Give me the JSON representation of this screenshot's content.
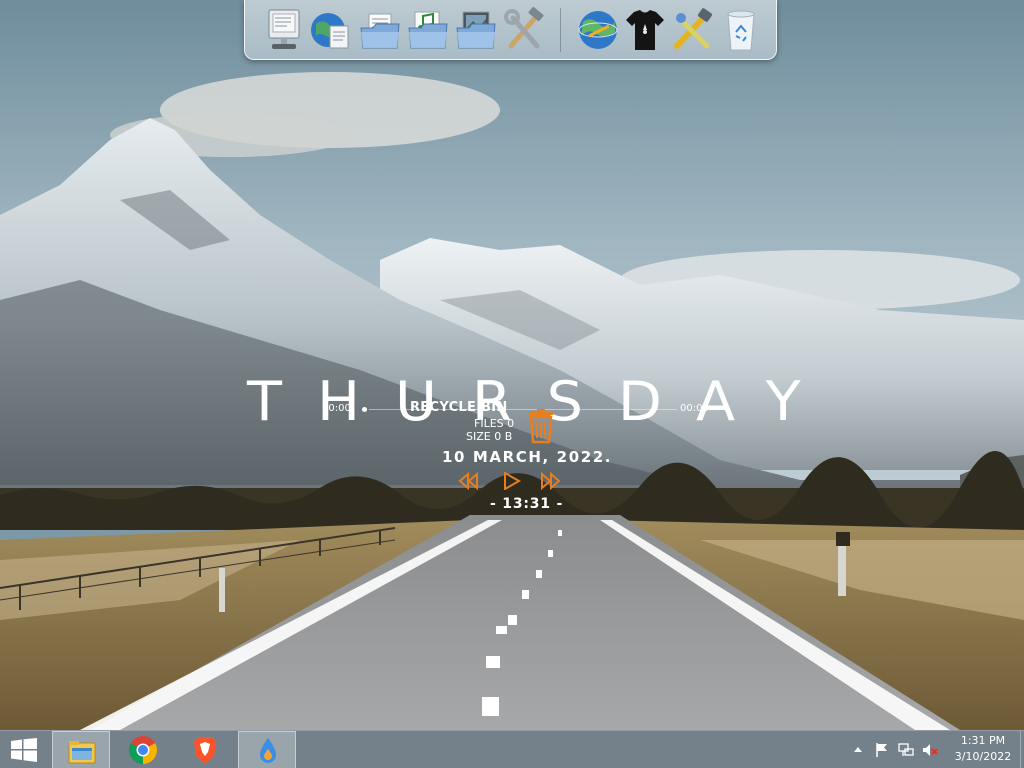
{
  "desktop": {
    "day_name": "THURSDAY",
    "date": "10  MARCH,  2022.",
    "clock": "- 13:31 -",
    "recycle_bin": {
      "title": "RECYCLE BIN",
      "files": "FILES 0",
      "size": "SIZE 0 B"
    },
    "media": {
      "elapsed": "00:00",
      "remaining": "00:00",
      "progress": 0,
      "accent_color": "#e67e22"
    }
  },
  "dock": {
    "icons": [
      {
        "name": "computer-icon"
      },
      {
        "name": "network-places-icon"
      },
      {
        "name": "documents-folder-icon"
      },
      {
        "name": "music-folder-icon"
      },
      {
        "name": "pictures-folder-icon"
      },
      {
        "name": "tools-icon"
      },
      {
        "name": "internet-globe-icon"
      },
      {
        "name": "tshirt-icon"
      },
      {
        "name": "settings-tools-icon"
      },
      {
        "name": "recycle-bin-icon"
      }
    ]
  },
  "taskbar": {
    "apps": [
      {
        "name": "file-explorer-icon",
        "active": true
      },
      {
        "name": "chrome-icon",
        "active": false
      },
      {
        "name": "brave-icon",
        "active": false
      },
      {
        "name": "raindrop-app-icon",
        "active": true
      }
    ],
    "tray": {
      "icons": [
        "chevron-up-icon",
        "flag-icon",
        "network-icon",
        "volume-muted-icon"
      ]
    },
    "clock_time": "1:31 PM",
    "clock_date": "3/10/2022"
  }
}
